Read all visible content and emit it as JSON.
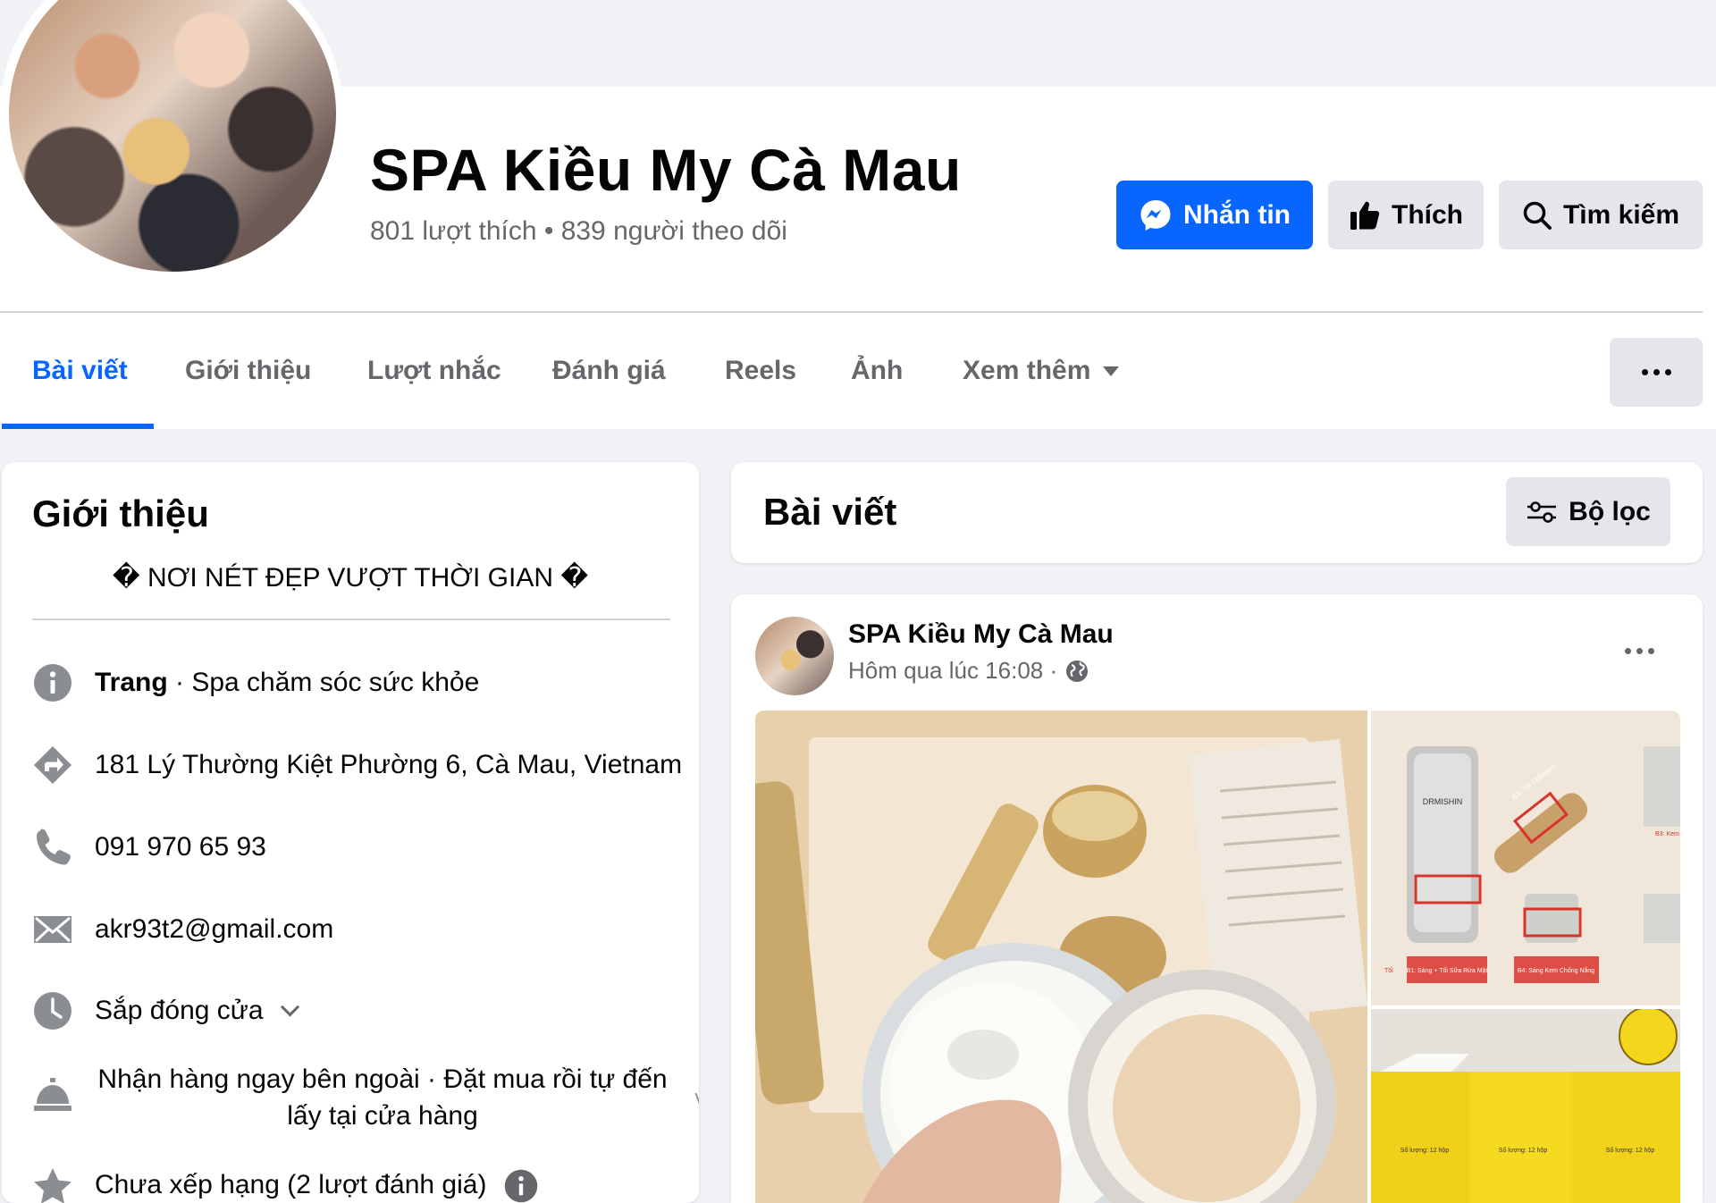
{
  "page": {
    "name": "SPA Kiều My Cà Mau",
    "stats": "801 lượt thích • 839 người theo dõi"
  },
  "actions": {
    "message_label": "Nhắn tin",
    "like_label": "Thích",
    "search_label": "Tìm kiếm"
  },
  "tabs": [
    {
      "label": "Bài viết",
      "active": true
    },
    {
      "label": "Giới thiệu"
    },
    {
      "label": "Lượt nhắc"
    },
    {
      "label": "Đánh giá"
    },
    {
      "label": "Reels"
    },
    {
      "label": "Ảnh"
    },
    {
      "label": "Xem thêm"
    }
  ],
  "intro": {
    "title": "Giới thiệu",
    "bio": "� NƠI NÉT ĐẸP VƯỢT THỜI GIAN �",
    "category_bold": "Trang",
    "category_rest": " · Spa chăm sóc sức khỏe",
    "address": "181 Lý Thường Kiệt Phường 6, Cà Mau, Vietnam",
    "phone": "091 970 65 93",
    "email": "akr93t2@gmail.com",
    "hours": "Sắp đóng cửa",
    "pickup": "Nhận hàng ngay bên ngoài · Đặt mua rồi tự đến lấy tại cửa hàng",
    "rating": "Chưa xếp hạng (2 lượt đánh giá)"
  },
  "posts": {
    "title": "Bài viết",
    "filter_label": "Bộ lọc"
  },
  "post": {
    "author": "SPA Kiều My Cà Mau",
    "time": "Hôm qua lúc 16:08 ·",
    "image_text": {
      "brand": "DRMISHIN",
      "label_b3_toi": "B3: Tối Collagen",
      "label_b3_kem": "B3: Kem",
      "label_b1": "B1: Sáng + Tối Sữa Rửa Mặt",
      "label_b4": "B4: Sáng Kem Chống Nắng",
      "label_toi": "Tối",
      "box_label": "Số lượng: 12 hộp"
    }
  },
  "colors": {
    "accent": "#0866ff",
    "background": "#f0f2f5",
    "secondary_text": "#65676b",
    "button_gray": "#e4e6eb"
  }
}
